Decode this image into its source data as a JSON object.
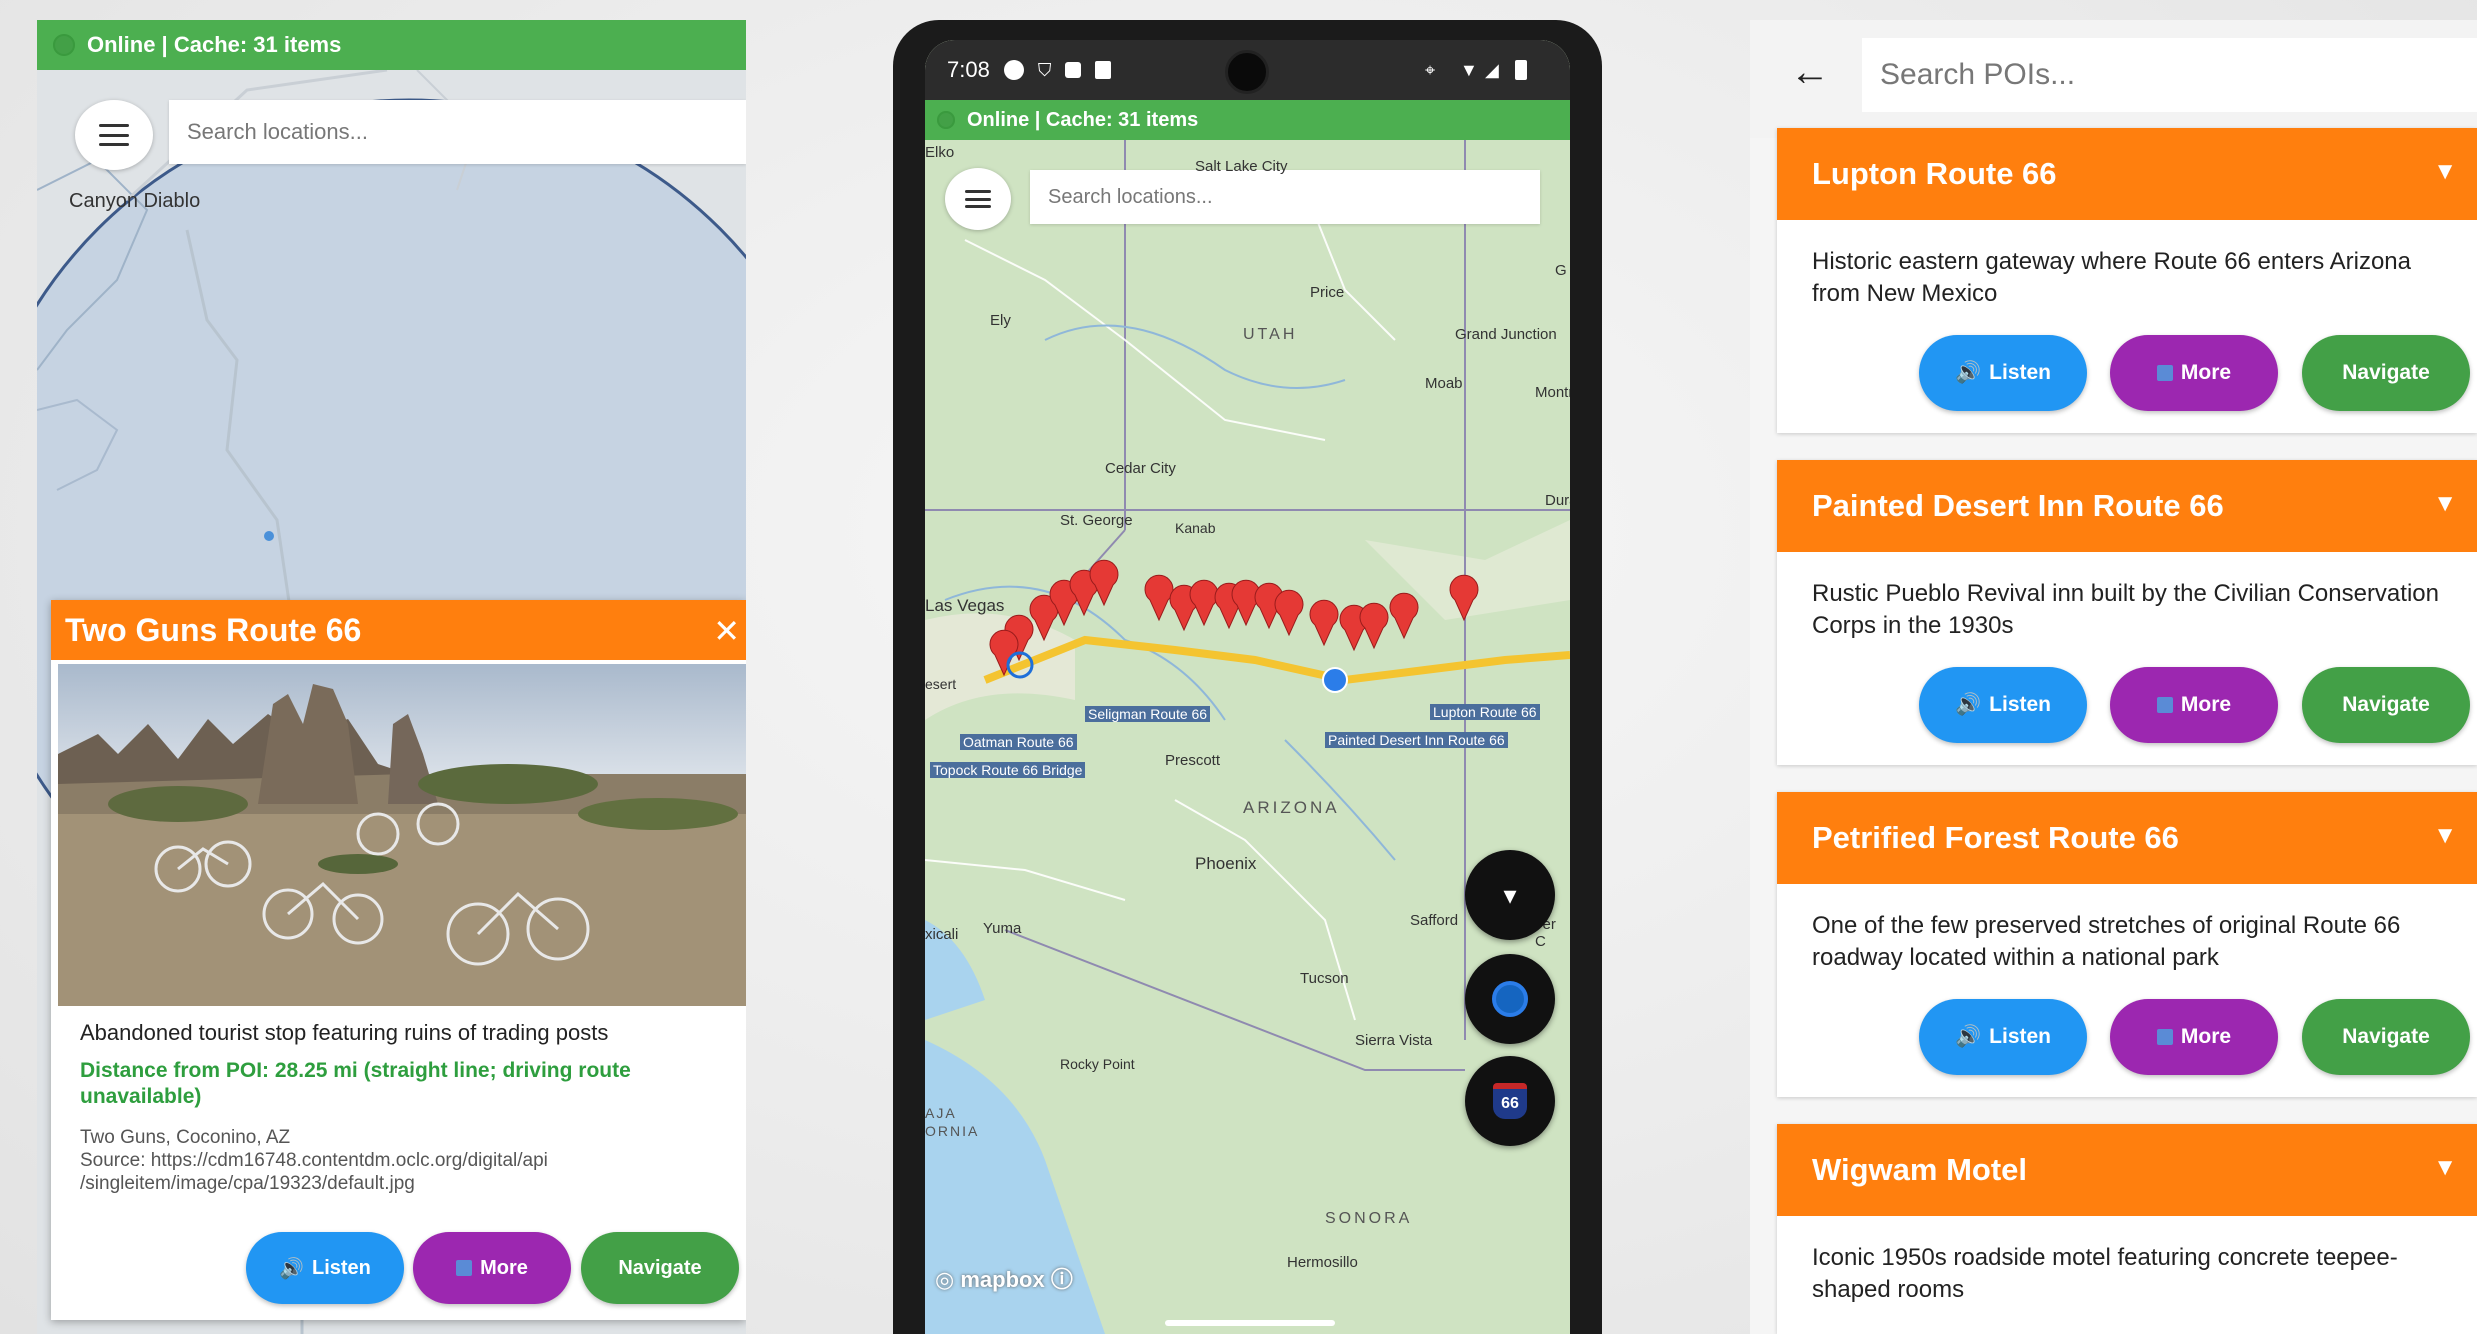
{
  "panel1": {
    "status": "Online | Cache: 31 items",
    "search_placeholder": "Search locations...",
    "map_label": "Canyon Diablo",
    "popup": {
      "title": "Two Guns Route 66",
      "close": "✕",
      "description": "Abandoned tourist stop featuring ruins of trading posts",
      "distance": "Distance from POI: 28.25 mi (straight line; driving route unavailable)",
      "location": "Two Guns, Coconino, AZ",
      "source": "Source: https://cdm16748.contentdm.oclc.org/digital/api /singleitem/image/cpa/19323/default.jpg",
      "buttons": {
        "listen": "Listen",
        "more": "More",
        "navigate": "Navigate"
      }
    }
  },
  "panel2": {
    "time": "7:08",
    "status": "Online | Cache: 31 items",
    "search_placeholder": "Search locations...",
    "map_labels": {
      "elko": "Elko",
      "salt_lake": "Salt Lake City",
      "price": "Price",
      "utah": "UTAH",
      "grand_junction": "Grand Junction",
      "moab": "Moab",
      "montrose": "Montr",
      "ely": "Ely",
      "cedar_city": "Cedar City",
      "st_george": "St. George",
      "kanab": "Kanab",
      "durango": "Dura",
      "las_vegas": "Las Vegas",
      "desert": "esert",
      "prescott": "Prescott",
      "arizona": "ARIZONA",
      "phoenix": "Phoenix",
      "mexicali": "xicali",
      "yuma": "Yuma",
      "safford": "Safford",
      "silver_city": "ver C",
      "tucson": "Tucson",
      "sierra_vista": "Sierra Vista",
      "rocky_point": "Rocky Point",
      "baja": "AJA ORNIA",
      "sonora": "SONORA",
      "hermosillo": "Hermosillo",
      "grand_edge": "G"
    },
    "poi_labels": {
      "seligman": "Seligman Route 66",
      "oatman": "Oatman Route 66",
      "topock": "Topock Route 66 Bridge",
      "lupton": "Lupton Route 66",
      "painted": "Painted Desert Inn Route 66"
    },
    "mapbox": "mapbox",
    "shield_text": "66",
    "colors": {
      "marker": "#e53935",
      "route": "#f4c430",
      "fab": "#111111"
    }
  },
  "panel3": {
    "search_placeholder": "Search POIs...",
    "cards": [
      {
        "title": "Lupton Route 66",
        "description": "Historic eastern gateway where Route 66 enters Arizona from New Mexico"
      },
      {
        "title": "Painted Desert Inn Route 66",
        "description": "Rustic Pueblo Revival inn built by the Civilian Conservation Corps in the 1930s"
      },
      {
        "title": "Petrified Forest Route 66",
        "description": "One of the few preserved stretches of original Route 66 roadway located within a national park"
      },
      {
        "title": "Wigwam Motel",
        "description": "Iconic 1950s roadside motel featuring concrete teepee-shaped rooms"
      }
    ],
    "buttons": {
      "listen": "Listen",
      "more": "More",
      "navigate": "Navigate"
    },
    "colors": {
      "header": "#ff7f0e",
      "listen": "#2196f3",
      "more": "#9c27b0",
      "navigate": "#43a047"
    }
  }
}
